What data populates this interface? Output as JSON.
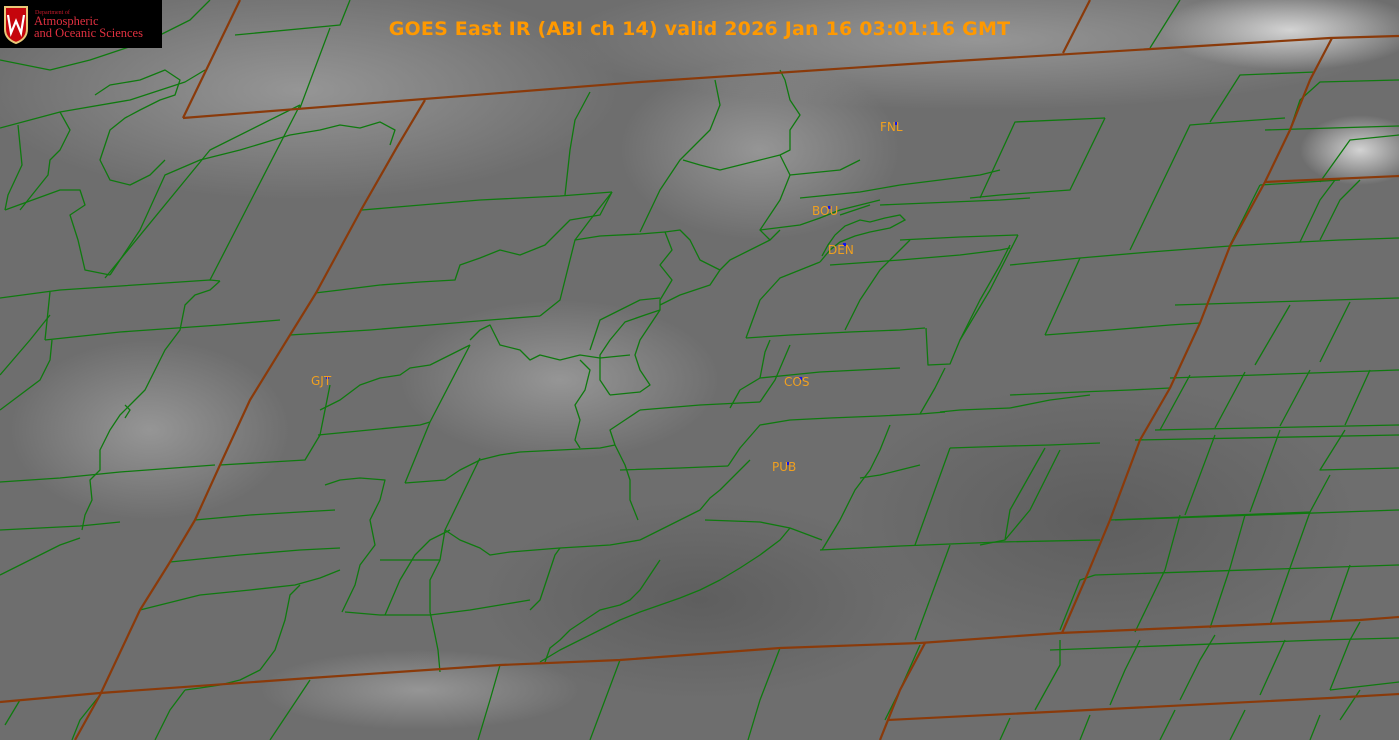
{
  "title": "GOES East IR (ABI ch 14) valid 2026 Jan 16 03:01:16 GMT",
  "logo": {
    "dept": "Department of",
    "line1": "Atmospheric",
    "line2": "and Oceanic Sciences",
    "emblem": "W"
  },
  "stations": [
    {
      "id": "FNL",
      "label": "FNL"
    },
    {
      "id": "BOU",
      "label": "BOU"
    },
    {
      "id": "DEN",
      "label": "DEN"
    },
    {
      "id": "GJT",
      "label": "GJT"
    },
    {
      "id": "COS",
      "label": "COS"
    },
    {
      "id": "PUB",
      "label": "PUB"
    }
  ],
  "colors": {
    "background": "#6e6e6e",
    "county_lines": "#0f7a0f",
    "state_lines": "#8a3a0a",
    "station_label": "#f0a020",
    "station_marker": "#1111ee",
    "title": "#ff9900"
  }
}
